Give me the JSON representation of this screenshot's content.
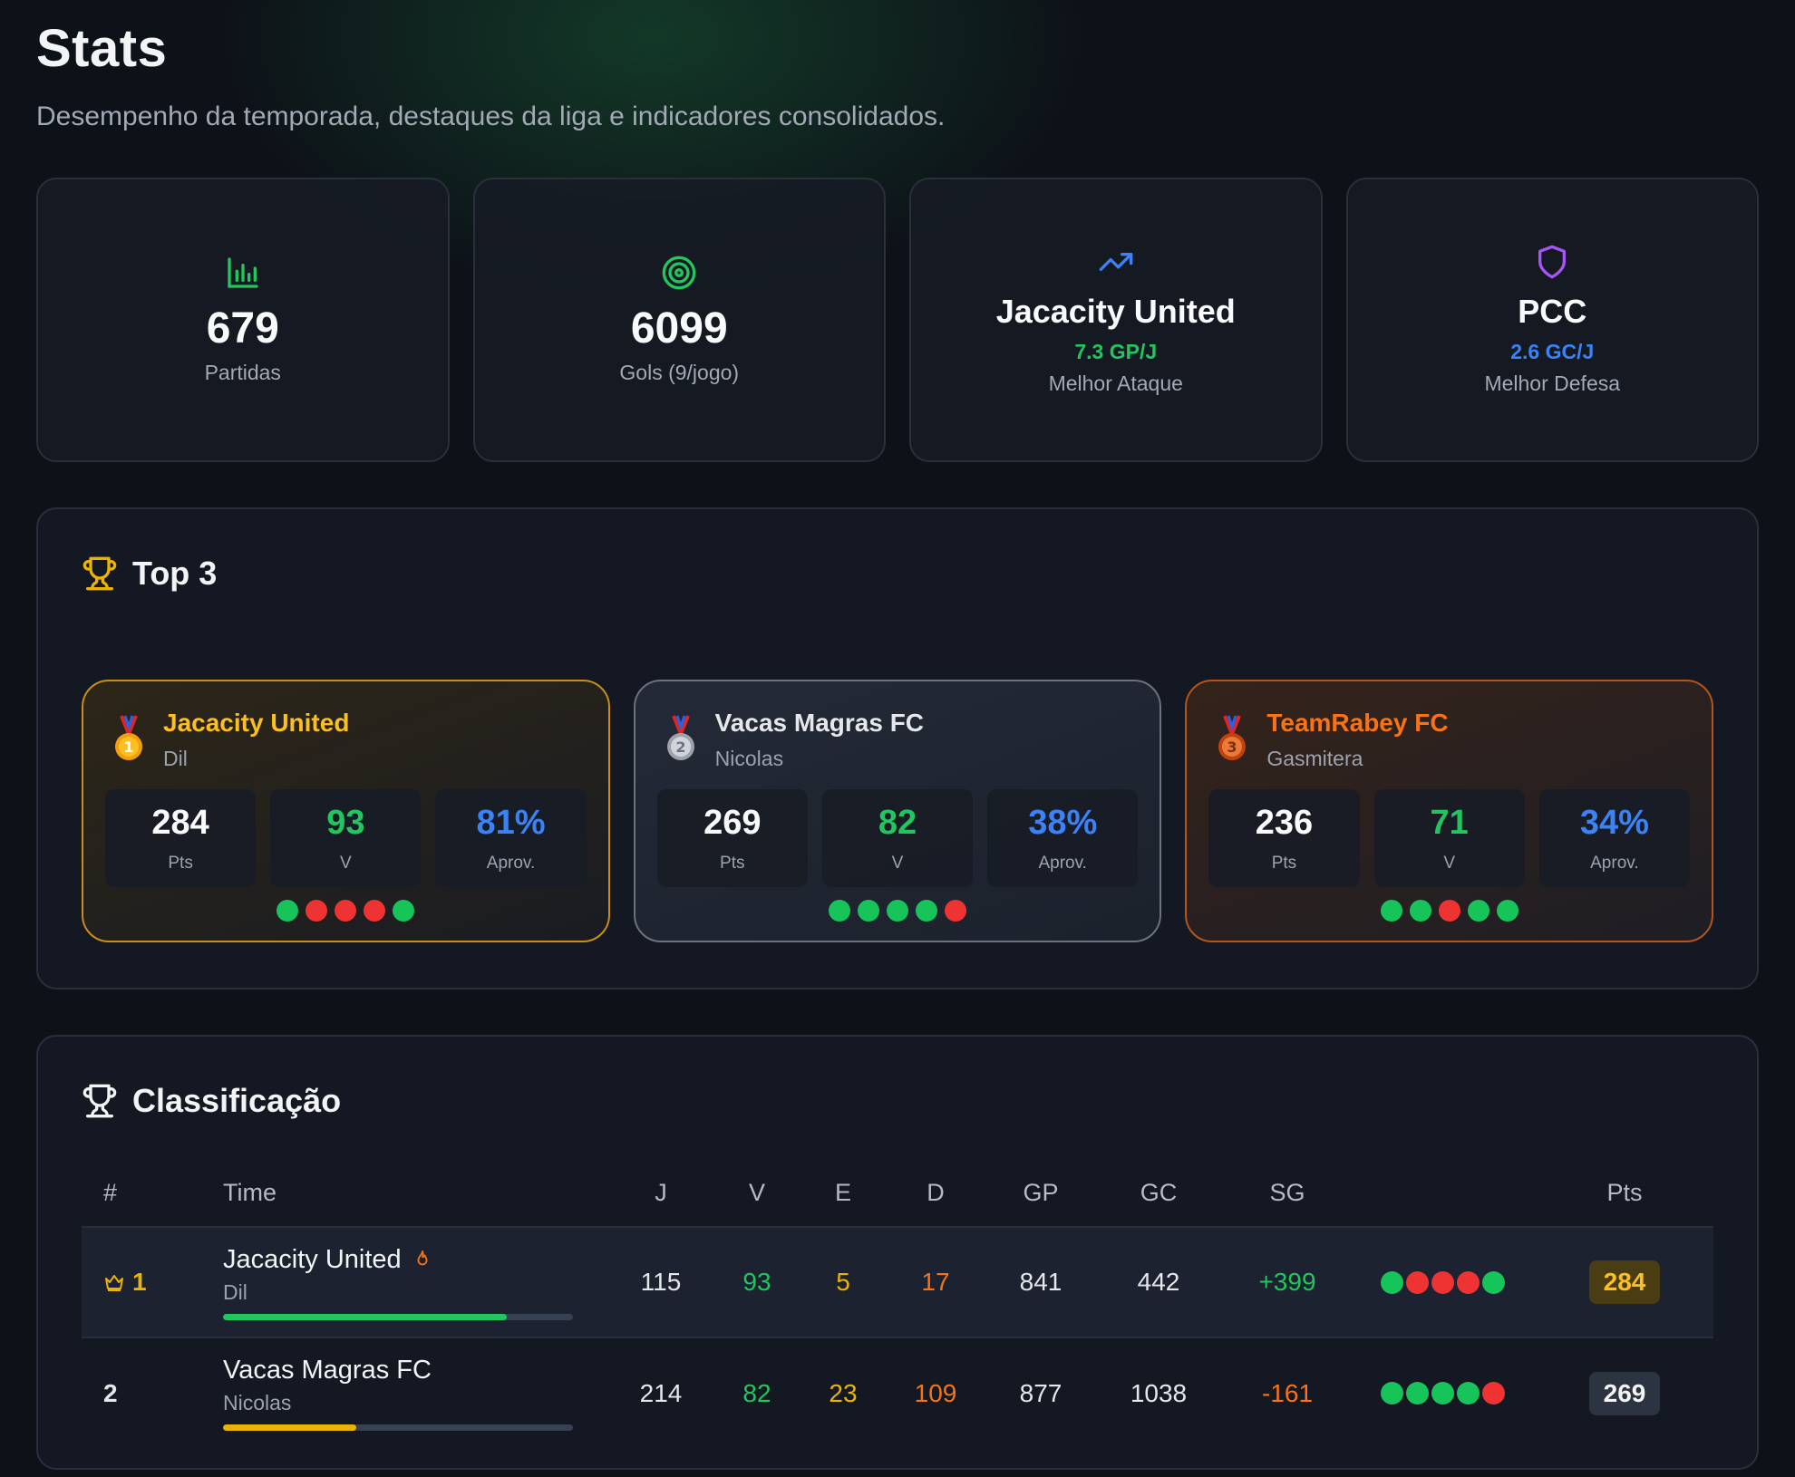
{
  "page": {
    "title": "Stats",
    "subtitle": "Desempenho da temporada, destaques da liga e indicadores consolidados."
  },
  "stats": [
    {
      "icon": "bar-chart-icon",
      "value": "679",
      "label": "Partidas",
      "color": "#22c55e"
    },
    {
      "icon": "target-icon",
      "value": "6099",
      "label": "Gols (9/jogo)",
      "color": "#22c55e"
    },
    {
      "icon": "trending-up-icon",
      "value": "Jacacity United",
      "sub": "7.3 GP/J",
      "label": "Melhor Ataque",
      "color": "#3b82f6",
      "sub_color": "#22c55e"
    },
    {
      "icon": "shield-icon",
      "value": "PCC",
      "sub": "2.6 GC/J",
      "label": "Melhor Defesa",
      "color": "#a855f7",
      "sub_color": "#3b82f6"
    }
  ],
  "top3": {
    "title": "Top 3",
    "teams": [
      {
        "rank": "1",
        "team": "Jacacity United",
        "owner": "Dil",
        "pts": "284",
        "pts_label": "Pts",
        "wins": "93",
        "wins_label": "V",
        "aprov": "81%",
        "aprov_label": "Aprov.",
        "form": [
          "w",
          "l",
          "l",
          "l",
          "w"
        ],
        "accent": "#fbbf24"
      },
      {
        "rank": "2",
        "team": "Vacas Magras FC",
        "owner": "Nicolas",
        "pts": "269",
        "pts_label": "Pts",
        "wins": "82",
        "wins_label": "V",
        "aprov": "38%",
        "aprov_label": "Aprov.",
        "form": [
          "w",
          "w",
          "w",
          "w",
          "l"
        ],
        "accent": "#e5e7eb"
      },
      {
        "rank": "3",
        "team": "TeamRabey FC",
        "owner": "Gasmitera",
        "pts": "236",
        "pts_label": "Pts",
        "wins": "71",
        "wins_label": "V",
        "aprov": "34%",
        "aprov_label": "Aprov.",
        "form": [
          "w",
          "w",
          "l",
          "w",
          "w"
        ],
        "accent": "#f97316"
      }
    ]
  },
  "table": {
    "title": "Classificação",
    "columns": [
      "#",
      "Time",
      "J",
      "V",
      "E",
      "D",
      "GP",
      "GC",
      "SG",
      "",
      "Pts"
    ],
    "rows": [
      {
        "rank": "1",
        "team": "Jacacity United",
        "owner": "Dil",
        "j": "115",
        "v": "93",
        "e": "5",
        "d": "17",
        "gp": "841",
        "gc": "442",
        "sg": "+399",
        "form": [
          "w",
          "l",
          "l",
          "l",
          "w"
        ],
        "pts": "284",
        "progress": 0.81,
        "bar_color": "#22c55e"
      },
      {
        "rank": "2",
        "team": "Vacas Magras FC",
        "owner": "Nicolas",
        "j": "214",
        "v": "82",
        "e": "23",
        "d": "109",
        "gp": "877",
        "gc": "1038",
        "sg": "-161",
        "form": [
          "w",
          "w",
          "w",
          "w",
          "l"
        ],
        "pts": "269",
        "progress": 0.38,
        "bar_color": "#eab308"
      }
    ]
  }
}
